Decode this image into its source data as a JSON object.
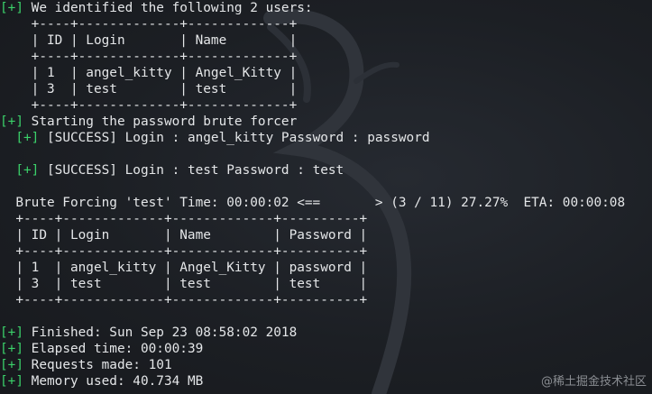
{
  "tag": "[+]",
  "intro": {
    "text": " We identified the following 2 users:",
    "table": [
      "    +----+-------------+-------------+",
      "    | ID | Login       | Name        |",
      "    +----+-------------+-------------+",
      "    | 1  | angel_kitty | Angel_Kitty |",
      "    | 3  | test        | test        |",
      "    +----+-------------+-------------+"
    ]
  },
  "brute": {
    "start": " Starting the password brute forcer",
    "success1": " [SUCCESS] Login : angel_kitty Password : password",
    "success2": " [SUCCESS] Login : test Password : test",
    "progress": "  Brute Forcing 'test' Time: 00:00:02 <==       > (3 / 11) 27.27%  ETA: 00:00:08"
  },
  "results_table": [
    "  +----+-------------+-------------+----------+",
    "  | ID | Login       | Name        | Password |",
    "  +----+-------------+-------------+----------+",
    "  | 1  | angel_kitty | Angel_Kitty | password |",
    "  | 3  | test        | test        | test     |",
    "  +----+-------------+-------------+----------+"
  ],
  "summary": {
    "finished": " Finished: Sun Sep 23 08:58:02 2018",
    "elapsed": " Elapsed time: 00:00:39",
    "requests": " Requests made: 101",
    "memory": " Memory used: 40.734 MB"
  },
  "watermark": "@稀土掘金技术社区",
  "colors": {
    "prompt": "#3bd16a",
    "text": "#e4e6e8",
    "background": "#1b1e23"
  }
}
